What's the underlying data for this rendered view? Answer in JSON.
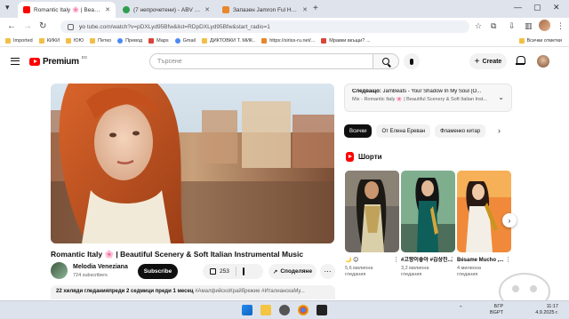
{
  "browser": {
    "tabs": [
      {
        "title": "Romantic Italy 🌸 | Beautif",
        "active": true,
        "favicon_color": "#ff0000"
      },
      {
        "title": "(7 непрочетени) - ABV поща",
        "active": false,
        "favicon_color": "#2e9e4f"
      },
      {
        "title": "Запазен Jamron Ful HD HP-25",
        "active": false,
        "favicon_color": "#e8872b"
      }
    ],
    "address": {
      "prefix": "yo",
      "url": "tube.com/watch?v=pDXLyd95Bfw&list=RDpDXLyd95Bfw&start_radio=1"
    },
    "bookmarks": [
      {
        "label": "Imported",
        "kind": "folder"
      },
      {
        "label": "КИКИ",
        "kind": "folder"
      },
      {
        "label": "ЮЮ",
        "kind": "folder"
      },
      {
        "label": "Петко",
        "kind": "folder"
      },
      {
        "label": "Превод",
        "kind": "g"
      },
      {
        "label": "Maps",
        "kind": "r"
      },
      {
        "label": "Gmail",
        "kind": "g"
      },
      {
        "label": "ДИКТОВКИ Т. МИК..",
        "kind": "folder"
      },
      {
        "label": "https://siriss-ru.net/...",
        "kind": "o"
      },
      {
        "label": "Мравки вкъщи? ...",
        "kind": "r"
      }
    ],
    "all_bookmarks": "Всички отметки"
  },
  "youtube": {
    "logo_word": "Premium",
    "logo_region": "BG",
    "search_placeholder": "Търсене",
    "create_label": "Create"
  },
  "video": {
    "title": "Romantic Italy 🌸 | Beautiful Scenery & Soft Italian Instrumental Music",
    "channel": "Melodia Veneziana",
    "subscribers": "724 subscribers",
    "subscribe_label": "Subscribe",
    "likes": "253",
    "share_label": "Споделяне",
    "views_line": "22 хиляди гледанияпреди 2 седмици  преди 1 месец",
    "tags": "#АмалфийскоКрайбрежие #ИталианскаМу..."
  },
  "up_next": {
    "label": "Следващо:",
    "next_title": "JamBeats - Your Shadow In My Soul (O...",
    "playlist": "Mix - Romantic Italy 🌸 | Beautiful Scenery & Soft Italian Inst..."
  },
  "chips": [
    "Всички",
    "От Елена Ереван",
    "Фламенко китар"
  ],
  "shorts": {
    "heading": "Шорти",
    "items": [
      {
        "title": "🌙 😊",
        "views": "5,6 милиона гледания"
      },
      {
        "title": "#고향이좋아 #김상진...",
        "views": "3,2 милиона гледания"
      },
      {
        "title": "Bésame Mucho ,...",
        "views": "4 милиона гледания"
      }
    ]
  },
  "taskbar": {
    "lang": "БГР",
    "region": "BGPT",
    "time": "11:17",
    "date": "4.9.2025 г."
  }
}
